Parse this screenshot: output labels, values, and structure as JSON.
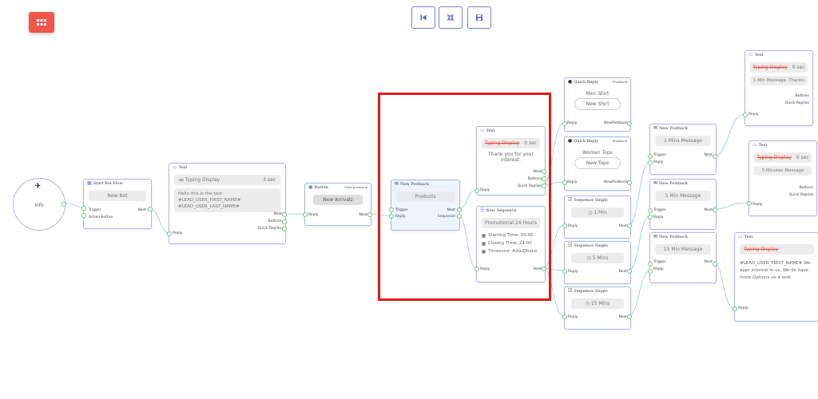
{
  "toolbar": {
    "menu_icon": "grid-icon",
    "reset_icon": "skip-back-icon",
    "fit_icon": "compress-icon",
    "save_icon": "save-icon"
  },
  "start": {
    "icon": "airplane-icon",
    "label": "Info"
  },
  "nodes": {
    "start_bot": {
      "title": "Start Bot Flow",
      "value": "New Bot",
      "ports": {
        "trigger": "Trigger",
        "action": "Action button",
        "next": "Next"
      }
    },
    "text1": {
      "title": "Text",
      "typing_icon": "keyboard-icon",
      "typing": "Typing Display",
      "typing_time": "3 sec",
      "message": "Hello this is the test. #LEAD_USER_FIRST_NAME# #LEAD_USER_LAST_NAME#",
      "ports": {
        "next": "Next",
        "buttons": "Buttons",
        "quick": "Quick Replies",
        "reply": "Reply"
      }
    },
    "button": {
      "title": "Button",
      "extra": "New postback",
      "value": "New Arrivalz",
      "ports": {
        "reply": "Reply",
        "next": "Next"
      }
    },
    "postback_products": {
      "title": "New Postback",
      "value": "Products",
      "ports": {
        "trigger": "Trigger",
        "reply": "Reply",
        "next": "Next",
        "sequence": "Sequence"
      }
    },
    "text2": {
      "title": "Text",
      "typing": "Typing Display",
      "typing_time": "0 sec",
      "message": "Thank you for your interest.",
      "ports": {
        "next": "Next",
        "buttons": "Buttons",
        "quick": "Quick Replies",
        "reply": "Reply"
      }
    },
    "sequence": {
      "title": "New Sequence",
      "value": "Promotional 24 Hours",
      "starting": "Starting Time: 00:00",
      "closing": "Closing Time: 24:00",
      "timezone": "Timezone: Asia/Dhaka",
      "ports": {
        "reply": "Reply",
        "next": "Next"
      }
    },
    "qr_men": {
      "title": "Quick Reply",
      "extra": "Postback",
      "text": "Men Shirt",
      "button": "New Shirt",
      "ports": {
        "reply": "Reply",
        "next": "NewPostback"
      }
    },
    "qr_women": {
      "title": "Quick Reply",
      "extra": "Postback",
      "text": "Women Tops",
      "button": "New Tops",
      "ports": {
        "reply": "Reply",
        "next": "NewPostback"
      }
    },
    "seq1": {
      "title": "Sequence Single",
      "value": "1 Min",
      "ports": {
        "reply": "Reply",
        "next": "Next"
      }
    },
    "seq5": {
      "title": "Sequence Single",
      "value": "5 Mins",
      "ports": {
        "reply": "Reply",
        "next": "Next"
      }
    },
    "seq15": {
      "title": "Sequence Single",
      "value": "15 Mins",
      "ports": {
        "reply": "Reply",
        "next": "Next"
      }
    },
    "pb1": {
      "title": "New Postback",
      "value": "1 Mins Message",
      "ports": {
        "trigger": "Trigger",
        "reply": "Reply",
        "next": "Next"
      }
    },
    "pb5": {
      "title": "New Postback",
      "value": "5 Min Message",
      "ports": {
        "trigger": "Trigger",
        "reply": "Reply",
        "next": "Next"
      }
    },
    "pb15": {
      "title": "New Postback",
      "value": "15 Min Message",
      "ports": {
        "trigger": "Trigger",
        "reply": "Reply",
        "next": "Next"
      }
    },
    "text3": {
      "title": "Text",
      "typing": "Typing Display",
      "typing_time": "0 sec",
      "message": "1 Min Message. Thanks",
      "ports": {
        "buttons": "Buttons",
        "quick": "Quick Replies",
        "reply": "Reply"
      }
    },
    "text4": {
      "title": "Text",
      "typing": "Typing Display",
      "typing_time": "0 sec",
      "message": "5 Minutes Message",
      "ports": {
        "buttons": "Buttons",
        "quick": "Quick Replies",
        "reply": "Reply"
      }
    },
    "text5": {
      "title": "Text",
      "typing": "Typing Display",
      "message": "#LEAD_USER_FIRST_NAME# We appr interest in us. We do have more Options ve a look.",
      "ports": {
        "reply": "Reply"
      }
    }
  },
  "colors": {
    "accent": "#7a7fd6",
    "node_border": "#aeb6e8",
    "highlight_box": "#e01b1b",
    "menu": "#f0564a",
    "connector": "#9cc4e4",
    "port": "#7cc27c",
    "strike": "#e4534a"
  }
}
